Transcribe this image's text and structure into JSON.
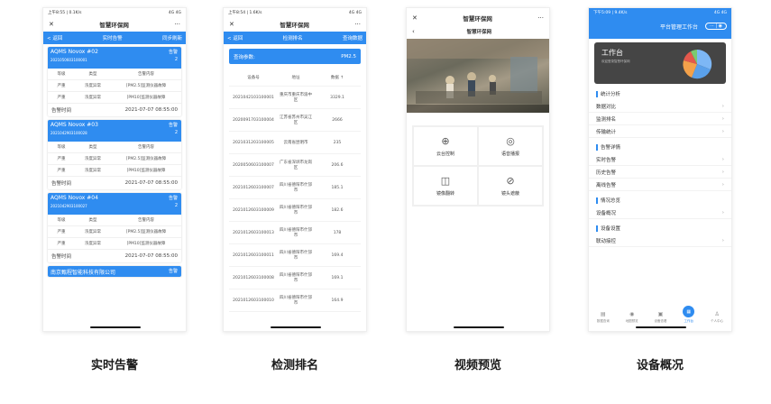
{
  "screens": [
    {
      "caption": "实时告警",
      "status": {
        "left": "上午8:55 | 0.1K/s",
        "right": "4G 4G"
      },
      "wx_title": "智慧环保网",
      "nav": {
        "back": "< 返回",
        "title": "实时告警",
        "action": "同步刷新"
      },
      "cards": [
        {
          "name": "AQMS Novox #02",
          "id": "2021050603100001",
          "label": "告警",
          "count": "2",
          "header": [
            "等级",
            "类型",
            "告警内容"
          ],
          "rows": [
            [
              "严重",
              "浓度异常",
              "[PM2.5]监测仪器故障"
            ],
            [
              "严重",
              "浓度异常",
              "[PM10]监测仪器故障"
            ]
          ],
          "time_label": "告警时间",
          "time": "2021-07-07 08:55:00"
        },
        {
          "name": "AQMS Novox #03",
          "id": "2021042903100028",
          "label": "告警",
          "count": "2",
          "header": [
            "等级",
            "类型",
            "告警内容"
          ],
          "rows": [
            [
              "严重",
              "浓度异常",
              "[PM2.5]监测仪器故障"
            ],
            [
              "严重",
              "浓度异常",
              "[PM10]监测仪器故障"
            ]
          ],
          "time_label": "告警时间",
          "time": "2021-07-07 08:55:00"
        },
        {
          "name": "AQMS Novox #04",
          "id": "2021042903100027",
          "label": "告警",
          "count": "2",
          "header": [
            "等级",
            "类型",
            "告警内容"
          ],
          "rows": [
            [
              "严重",
              "浓度异常",
              "[PM2.5]监测仪器故障"
            ],
            [
              "严重",
              "浓度异常",
              "[PM10]监测仪器故障"
            ]
          ],
          "time_label": "告警时间",
          "time": "2021-07-07 08:55:00"
        }
      ],
      "footer_card": {
        "name": "南京甄程智能科技有限公司",
        "label": "告警"
      }
    },
    {
      "caption": "检测排名",
      "status": {
        "left": "上午8:54 | 1.6K/s",
        "right": "4G 4G"
      },
      "wx_title": "智慧环保网",
      "nav": {
        "back": "< 返回",
        "title": "检测排名",
        "action": "查询数据"
      },
      "query": {
        "label": "查询参数:",
        "value": "PM2.5"
      },
      "table_header": [
        "设备号",
        "地址",
        "数据 ↑"
      ],
      "rows": [
        [
          "2021042103100001",
          "重庆市重庆市渝中区",
          "3329.1"
        ],
        [
          "2020091703100004",
          "江苏省苏州市吴江区",
          "2666"
        ],
        [
          "2021031203100005",
          "云南省昆明市",
          "235"
        ],
        [
          "2020050603100007",
          "广东省深圳市龙岗区",
          "206.6"
        ],
        [
          "2021012603100007",
          "四川省德阳市什邡市",
          "185.1"
        ],
        [
          "2021012603100009",
          "四川省德阳市什邡市",
          "182.6"
        ],
        [
          "2021012603100013",
          "四川省德阳市什邡市",
          "178"
        ],
        [
          "2021012603100011",
          "四川省德阳市什邡市",
          "169.4"
        ],
        [
          "2021012603100008",
          "四川省德阳市什邡市",
          "169.1"
        ],
        [
          "2021012603100010",
          "四川省德阳市什邡市",
          "164.9"
        ]
      ]
    },
    {
      "caption": "视频预览",
      "wx_title": "智慧环保网",
      "sub_title": "智慧环保网",
      "grid": [
        {
          "icon": "joystick-icon",
          "label": "云台控制"
        },
        {
          "icon": "speaker-icon",
          "label": "语音播报"
        },
        {
          "icon": "mirror-icon",
          "label": "镜像翻转"
        },
        {
          "icon": "eye-off-icon",
          "label": "镜头遮蔽"
        }
      ]
    },
    {
      "caption": "设备概况",
      "status": {
        "left": "下午5:09 | 9.4K/s",
        "right": "4G 4G"
      },
      "app_title": "平台管理工作台",
      "header": {
        "title": "工作台",
        "subtitle": "欢迎登录智慧环保网"
      },
      "sections": [
        {
          "title": "统计分析",
          "items": [
            "数据对比",
            "监测排名",
            "传输统计"
          ]
        },
        {
          "title": "告警详情",
          "items": [
            "实时告警",
            "历史告警",
            "离线告警"
          ]
        },
        {
          "title": "情况总览",
          "items": [
            "设备概况"
          ]
        },
        {
          "title": "设备设置",
          "items": [
            "联动接控"
          ]
        }
      ],
      "tabs": [
        "数据查询",
        "地图预览",
        "设备查看",
        "工作台",
        "个人中心"
      ],
      "accent": "#2f8cf0"
    }
  ]
}
